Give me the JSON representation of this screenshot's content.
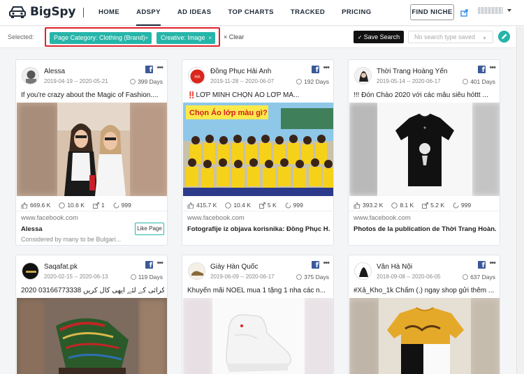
{
  "app": {
    "brand": "BigSpy"
  },
  "nav": {
    "items": [
      {
        "label": "HOME",
        "active": false
      },
      {
        "label": "ADSPY",
        "active": true
      },
      {
        "label": "AD IDEAS",
        "active": false
      },
      {
        "label": "TOP CHARTS",
        "active": false
      },
      {
        "label": "TRACKED",
        "active": false
      },
      {
        "label": "PRICING",
        "active": false
      }
    ],
    "find_niche": "FIND NICHE"
  },
  "filters": {
    "selected_label": "Selected:",
    "chips": [
      {
        "label": "Page Category: Clothing (Brand)",
        "remove": "×"
      },
      {
        "label": "Creative: Image",
        "remove": "×"
      }
    ],
    "clear_label": "× Clear",
    "save_search_label": "Save Search",
    "saved_placeholder": "No search type saved",
    "highlight_color": "#e0212d",
    "chip_color": "#26b5a9"
  },
  "cards": [
    {
      "page_name": "Alessa",
      "date_range": "2019-04-19 -- 2020-05-21",
      "days": "399 Days",
      "text": "If you're crazy about the Magic of Fashion....",
      "stats": {
        "likes": "669.6 K",
        "comments": "10.6 K",
        "shares": "1",
        "views": "999"
      },
      "site": "www.facebook.com",
      "link_title": "Alessa",
      "link_desc": "Considered by many to be Bulgari...",
      "button": "Like Page"
    },
    {
      "page_name": "Đồng Phục Hải Anh",
      "date_range": "2019-11-28 -- 2020-06-07",
      "days": "192 Days",
      "text": "‼️LỚP MÌNH CHỌN ÁO LỚP MÀ...",
      "image_caption": "Chọn Áo lớp màu gì?",
      "stats": {
        "likes": "415.7 K",
        "comments": "10.4 K",
        "shares": "5 K",
        "views": "999"
      },
      "site": "www.facebook.com",
      "link_title": "Fotografije iz objava korisnika: Đồng Phục H...",
      "link_desc": "",
      "button": ""
    },
    {
      "page_name": "Thời Trang Hoàng Yến",
      "date_range": "2019-05-14 -- 2020-06-17",
      "days": "401 Days",
      "text": "!!! Đón Chào 2020 với các mẫu siêu hóttt ...",
      "stats": {
        "likes": "393.2 K",
        "comments": "8.1 K",
        "shares": "5.2 K",
        "views": "999"
      },
      "site": "www.facebook.com",
      "link_title": "Photos de la publication de Thời Trang Hoàn...",
      "link_desc": "",
      "button": ""
    },
    {
      "page_name": "Saqafat.pk",
      "date_range": "2020-02-15 -- 2020-06-13",
      "days": "119 Days",
      "text": "2020 03166773338 ﮎ ﮐﺮاﺋﯽ ﮐﮯ ﻟﺌﮯ اﯾﮭﯽ ﮐﺎل ﮐﺮﯾﮟ"
    },
    {
      "page_name": "Giày Hàn Quốc",
      "date_range": "2019-06-09 -- 2020-06-17",
      "days": "375 Days",
      "text": "Khuyến mãi NOEL mua 1 tặng 1 nha các n..."
    },
    {
      "page_name": "Vân Hà Nội",
      "date_range": "2018-09-08 -- 2020-06-05",
      "days": "637 Days",
      "text": "#Xả_Kho_1k Chấm (.) ngay shop gửi thêm ..."
    }
  ]
}
